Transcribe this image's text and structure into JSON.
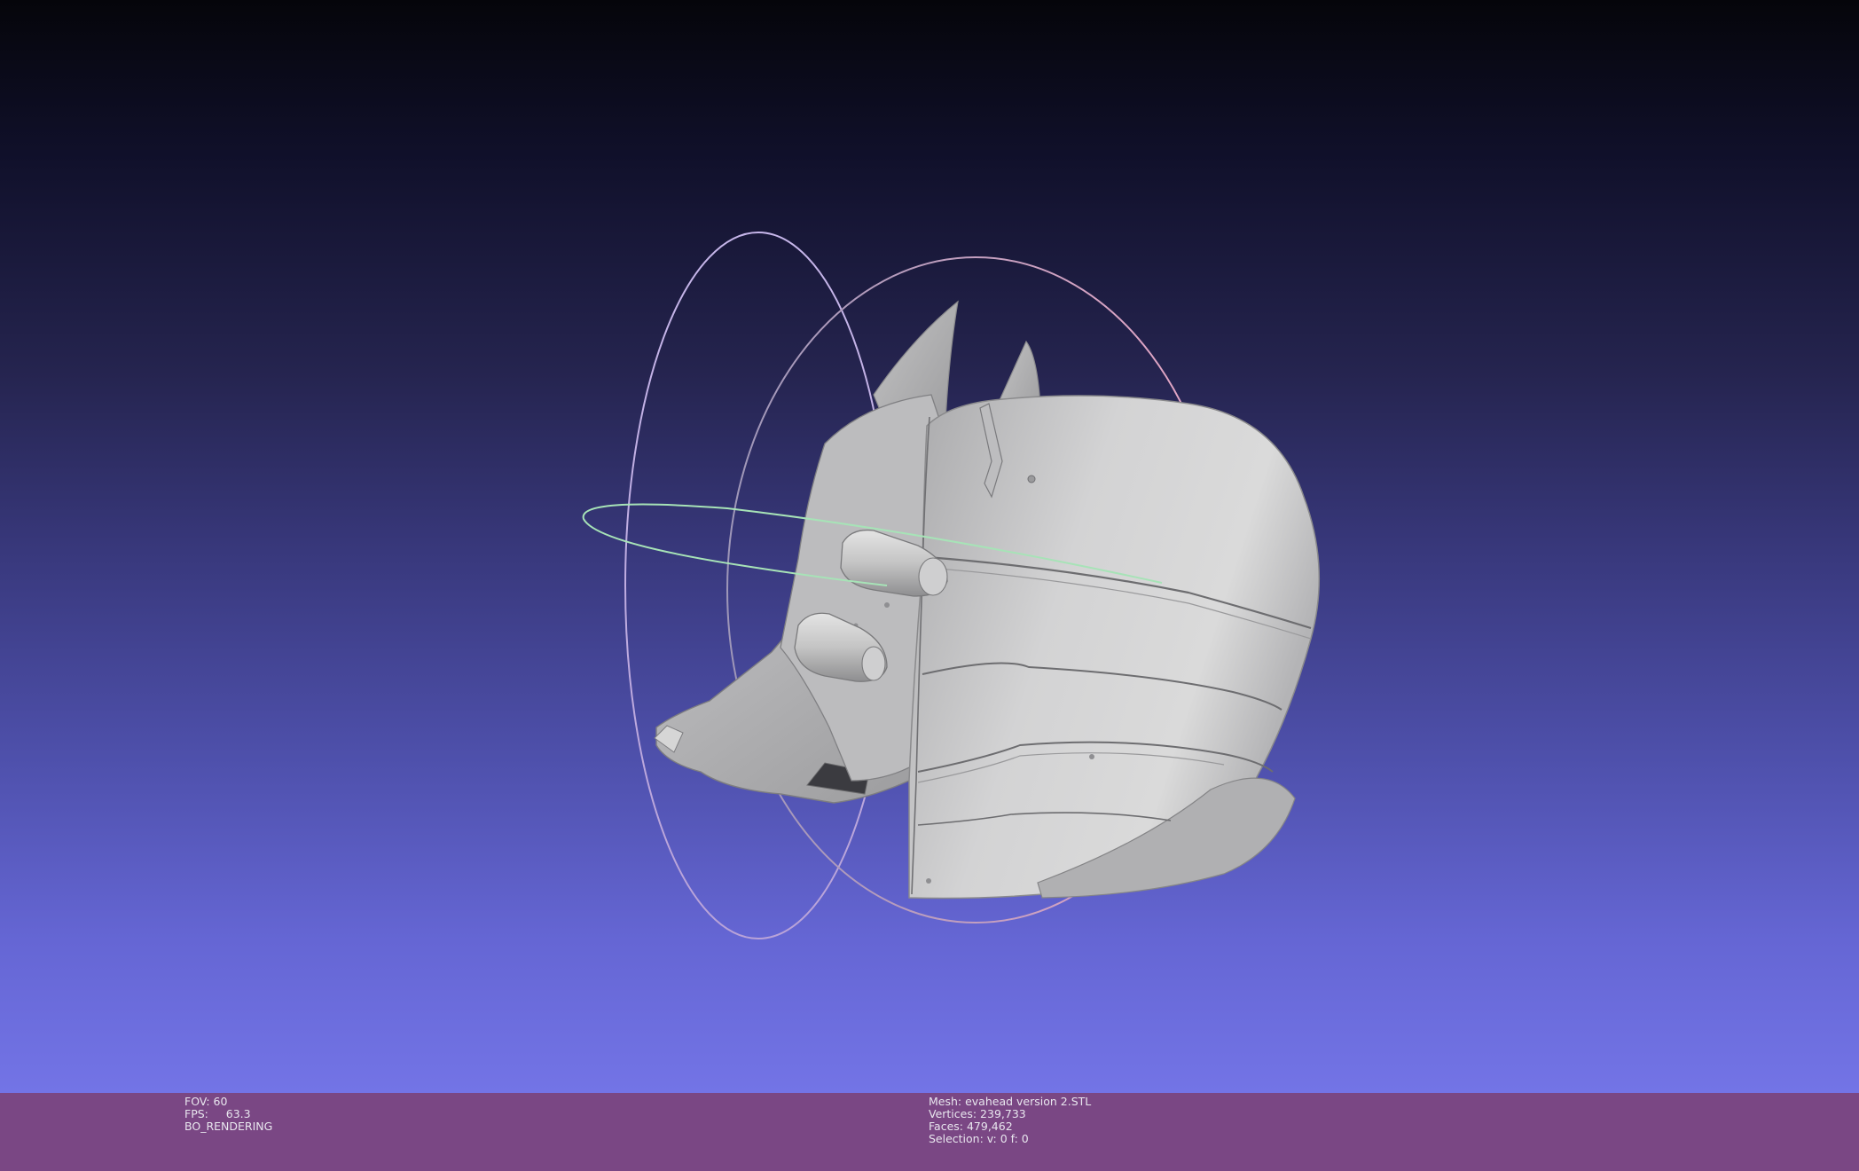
{
  "viewer": {
    "background_top": "#05050a",
    "background_bottom": "#7374e6",
    "model_color": "#c8c8c8",
    "model_icon": "3d-mesh-model",
    "trackball_colors": {
      "vertical_ring": "#c8b8e8",
      "horizontal_ring": "#a8e8b8",
      "outer_ring": "#e8a8c8"
    }
  },
  "status_bar": {
    "background": "#7a4784",
    "left": {
      "fov": "FOV: 60",
      "fps": "FPS:     63.3",
      "mode": "BO_RENDERING"
    },
    "right": {
      "mesh": "Mesh: evahead version 2.STL",
      "vertices": "Vertices: 239,733",
      "faces": "Faces: 479,462",
      "selection": "Selection: v: 0 f: 0"
    }
  }
}
